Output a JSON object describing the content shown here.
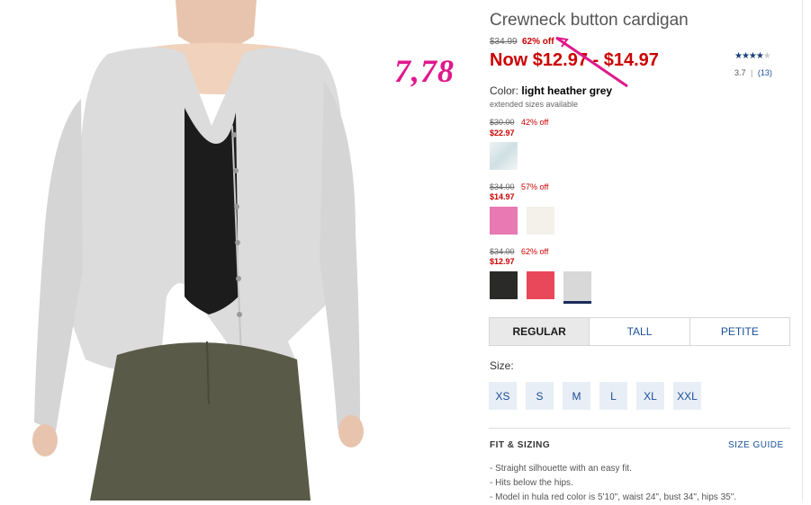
{
  "annotation": "7,78",
  "product": {
    "title": "Crewneck button cardigan",
    "original_price": "$34.99",
    "discount": "62% off",
    "now_price": "Now $12.97 - $14.97",
    "stars": "★★★★",
    "stars_dim": "★",
    "rating": "3.7",
    "review_sep": "|",
    "review_count": "(13)",
    "color_label": "Color:",
    "color_value": "light heather grey",
    "extended_sizes": "extended sizes available"
  },
  "color_groups": [
    {
      "original": "$30.00",
      "discount": "42% off",
      "price": "$22.97",
      "swatches": [
        {
          "name": "light tie-dye",
          "color": "#dfe8ea"
        }
      ]
    },
    {
      "original": "$34.00",
      "discount": "57% off",
      "price": "$14.97",
      "swatches": [
        {
          "name": "pink",
          "color": "#e879b3"
        },
        {
          "name": "ivory",
          "color": "#f4f1ea"
        }
      ]
    },
    {
      "original": "$34.00",
      "discount": "62% off",
      "price": "$12.97",
      "swatches": [
        {
          "name": "black",
          "color": "#2a2a28"
        },
        {
          "name": "hula red",
          "color": "#e8485a"
        },
        {
          "name": "light heather grey",
          "color": "#d8d8d8"
        }
      ]
    }
  ],
  "fit_tabs": [
    "REGULAR",
    "TALL",
    "PETITE"
  ],
  "selected_fit": "REGULAR",
  "size_label": "Size:",
  "sizes": [
    "XS",
    "S",
    "M",
    "L",
    "XL",
    "XXL"
  ],
  "fit_sizing": {
    "heading": "FIT & SIZING",
    "guide_link": "SIZE GUIDE",
    "bullets": [
      "- Straight silhouette with an easy fit.",
      "- Hits below the hips.",
      "- Model in hula red color is 5'10\", waist 24\", bust 34\", hips 35\"."
    ]
  },
  "colors": {
    "accent_red": "#cc0000",
    "link_blue": "#1a4f9a",
    "annotation_pink": "#e0198c"
  }
}
